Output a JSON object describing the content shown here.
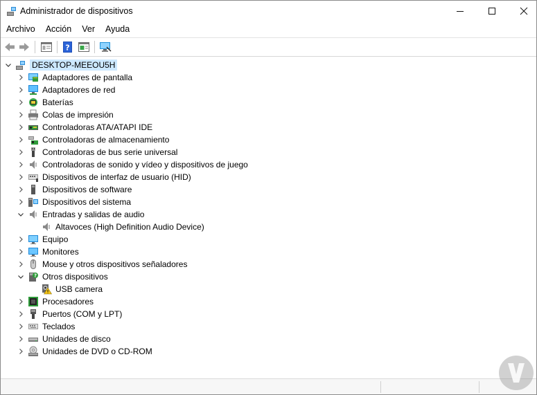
{
  "window": {
    "title": "Administrador de dispositivos",
    "controls": {
      "minimize": "—",
      "maximize": "☐",
      "close": "✕"
    }
  },
  "menu": {
    "items": [
      "Archivo",
      "Acción",
      "Ver",
      "Ayuda"
    ]
  },
  "toolbar": {
    "buttons": [
      "back-arrow-icon",
      "forward-arrow-icon",
      "properties-view-icon",
      "help-icon",
      "show-hidden-icon",
      "scan-hardware-icon"
    ]
  },
  "tree": {
    "root": "DESKTOP-MEEOU5H",
    "items": [
      {
        "label": "Adaptadores de pantalla",
        "icon": "display-adapter-icon"
      },
      {
        "label": "Adaptadores de red",
        "icon": "network-adapter-icon"
      },
      {
        "label": "Baterías",
        "icon": "battery-icon"
      },
      {
        "label": "Colas de impresión",
        "icon": "printer-icon"
      },
      {
        "label": "Controladoras ATA/ATAPI IDE",
        "icon": "ide-controller-icon"
      },
      {
        "label": "Controladoras de almacenamiento",
        "icon": "storage-controller-icon"
      },
      {
        "label": "Controladoras de bus serie universal",
        "icon": "usb-icon"
      },
      {
        "label": "Controladoras de sonido y vídeo y dispositivos de juego",
        "icon": "speaker-icon"
      },
      {
        "label": "Dispositivos de interfaz de usuario (HID)",
        "icon": "hid-keyboard-icon"
      },
      {
        "label": "Dispositivos de software",
        "icon": "software-device-icon"
      },
      {
        "label": "Dispositivos del sistema",
        "icon": "system-device-icon"
      },
      {
        "label": "Entradas y salidas de audio",
        "icon": "audio-speaker-icon",
        "expanded": true
      },
      {
        "label": "Altavoces (High Definition Audio Device)",
        "icon": "speaker-icon",
        "child": true
      },
      {
        "label": "Equipo",
        "icon": "computer-monitor-icon"
      },
      {
        "label": "Monitores",
        "icon": "monitor-icon"
      },
      {
        "label": "Mouse y otros dispositivos señaladores",
        "icon": "mouse-icon"
      },
      {
        "label": "Otros dispositivos",
        "icon": "unknown-device-icon",
        "expanded": true
      },
      {
        "label": "USB camera",
        "icon": "warning-device-icon",
        "child": true
      },
      {
        "label": "Procesadores",
        "icon": "processor-icon"
      },
      {
        "label": "Puertos (COM y LPT)",
        "icon": "port-icon"
      },
      {
        "label": "Teclados",
        "icon": "keyboard-icon"
      },
      {
        "label": "Unidades de disco",
        "icon": "disk-drive-icon"
      },
      {
        "label": "Unidades de DVD o CD-ROM",
        "icon": "dvd-drive-icon"
      }
    ]
  },
  "colors": {
    "selection": "#cce8ff",
    "monitor_blue": "#1e90d8"
  }
}
